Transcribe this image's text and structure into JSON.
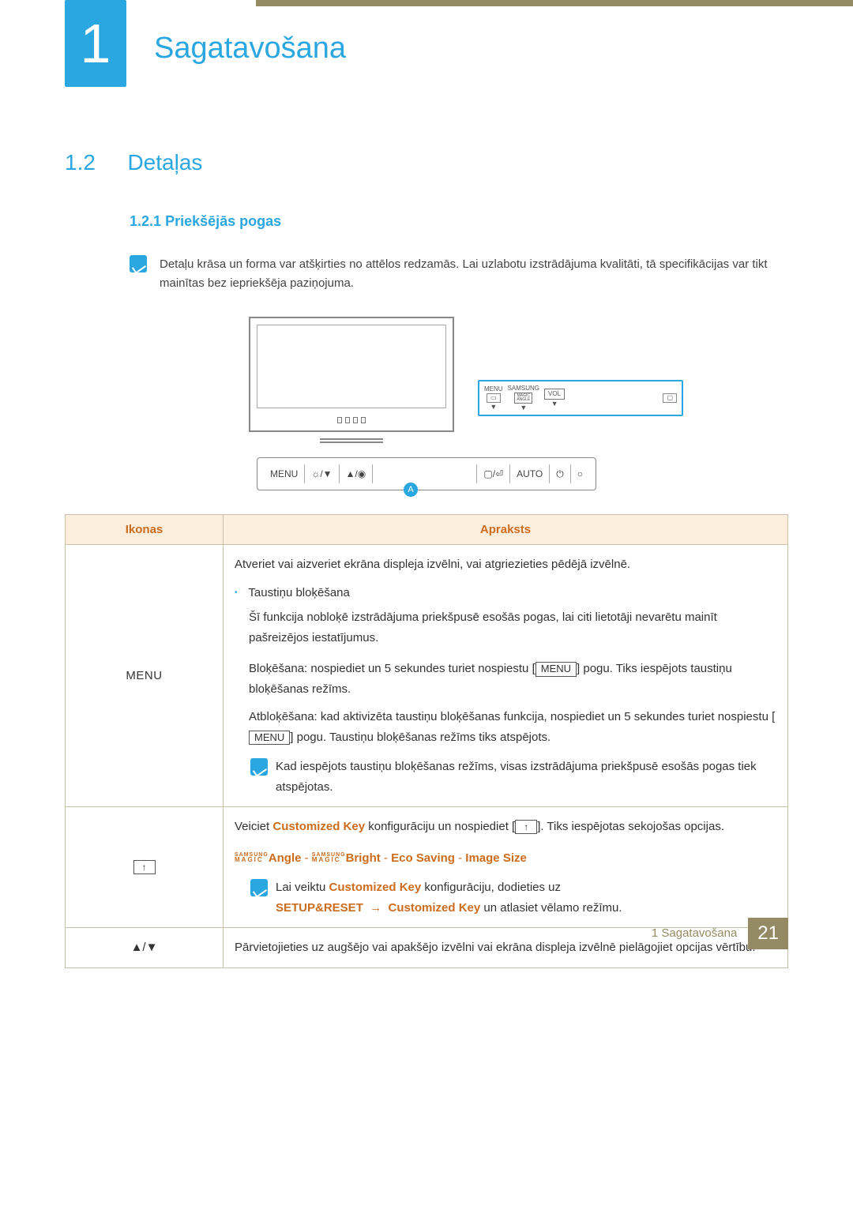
{
  "chapter": {
    "number": "1",
    "title": "Sagatavošana"
  },
  "section": {
    "number": "1.2",
    "title": "Detaļas"
  },
  "subsection": {
    "number": "1.2.1",
    "title": "Priekšējās pogas"
  },
  "intro_note": "Detaļu krāsa un forma var atšķirties no attēlos redzamās. Lai uzlabotu izstrādājuma kvalitāti, tā specifikācijas var tikt mainītas bez iepriekšēja paziņojuma.",
  "callout_letter": "A",
  "callout": {
    "menu": "MENU",
    "samsung": "SAMSUNG",
    "magic": "MAGIC",
    "angle": "ANGLE",
    "vol": "VOL"
  },
  "button_strip": {
    "menu": "MENU",
    "auto": "AUTO"
  },
  "table": {
    "head": {
      "icons": "Ikonas",
      "desc": "Apraksts"
    },
    "row1": {
      "icon": "MENU",
      "p1": "Atveriet vai aizveriet ekrāna displeja izvēlni, vai atgriezieties pēdējā izvēlnē.",
      "bullet_title": "Taustiņu bloķēšana",
      "bullet_text": "Šī funkcija nobloķē izstrādājuma priekšpusē esošās pogas, lai citi lietotāji nevarētu mainīt pašreizējos iestatījumus.",
      "lock_a": "Bloķēšana: nospiediet un 5 sekundes turiet nospiestu [",
      "lock_btn": "MENU",
      "lock_b": "] pogu. Tiks iespējots taustiņu bloķēšanas režīms.",
      "unlock_a": "Atbloķēšana: kad aktivizēta taustiņu bloķēšanas funkcija, nospiediet un 5 sekundes turiet nospiestu [",
      "unlock_btn": "MENU",
      "unlock_b": "] pogu. Taustiņu bloķēšanas režīms tiks atspējots.",
      "note": "Kad iespējots taustiņu bloķēšanas režīms, visas izstrādājuma priekšpusē esošās pogas tiek atspējotas."
    },
    "row2": {
      "p1a": "Veiciet ",
      "ck": "Customized Key",
      "p1b": " konfigurāciju un nospiediet [",
      "p1c": "]. Tiks iespējotas sekojošas opcijas.",
      "opt_angle": "Angle",
      "opt_bright": "Bright",
      "opt_eco": "Eco Saving",
      "opt_img": "Image Size",
      "note_a": "Lai veiktu ",
      "note_b": " konfigurāciju, dodieties uz ",
      "setup": "SETUP&RESET",
      "arrow": "→",
      "note_c": " un atlasiet vēlamo režīmu."
    },
    "row3": {
      "icon": "▲/▼",
      "text": "Pārvietojieties uz augšējo vai apakšējo izvēlni vai ekrāna displeja izvēlnē pielāgojiet opcijas vērtību."
    }
  },
  "footer": {
    "label": "1 Sagatavošana",
    "page": "21"
  }
}
